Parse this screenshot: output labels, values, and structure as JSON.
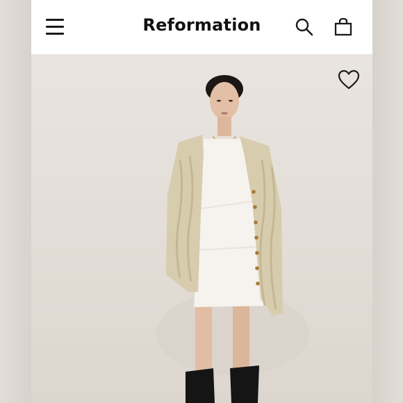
{
  "header": {
    "brand": "Reformation",
    "icons": {
      "menu": "hamburger-menu-icon",
      "search": "search-icon",
      "bag": "shopping-bag-icon"
    }
  },
  "product_image": {
    "icons": {
      "wishlist": "heart-icon"
    }
  },
  "colors": {
    "header_bg": "#ffffff",
    "text": "#111111",
    "photo_bg": "#e6e1dc",
    "cardigan": "#d8ccae",
    "dress": "#f6f3ee",
    "boots": "#151515"
  }
}
